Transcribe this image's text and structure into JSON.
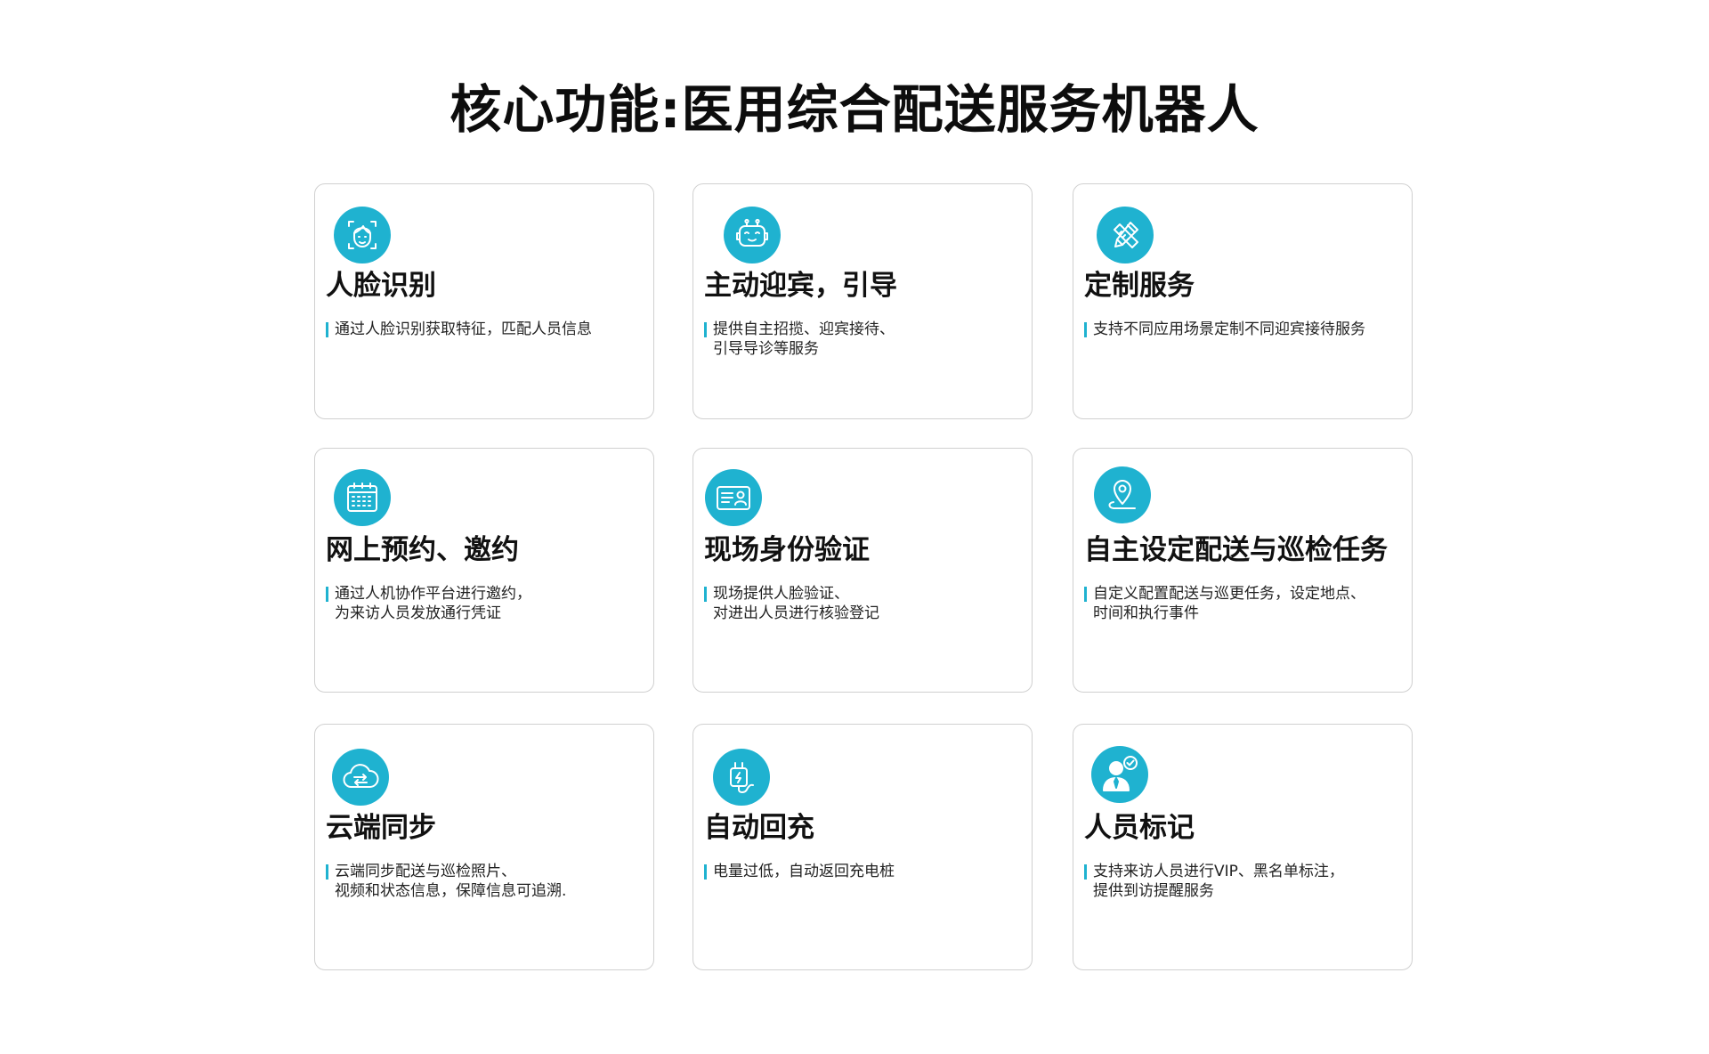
{
  "title": "核心功能:医用综合配送服务机器人",
  "colors": {
    "accent": "#1fb2d0",
    "border": "#d0d0d0",
    "text": "#111111"
  },
  "cards": [
    {
      "icon": "face-recognition-icon",
      "title": "人脸识别",
      "desc": [
        "通过人脸识别获取特征，匹配人员信息"
      ]
    },
    {
      "icon": "robot-icon",
      "title": "主动迎宾，引导",
      "desc": [
        "提供自主招揽、迎宾接待、",
        "引导导诊等服务"
      ]
    },
    {
      "icon": "pencil-ruler-icon",
      "title": "定制服务",
      "desc": [
        "支持不同应用场景定制不同迎宾接待服务"
      ]
    },
    {
      "icon": "calendar-icon",
      "title": "网上预约、邀约",
      "desc": [
        "通过人机协作平台进行邀约，",
        "为来访人员发放通行凭证"
      ]
    },
    {
      "icon": "id-card-icon",
      "title": "现场身份验证",
      "desc": [
        "现场提供人脸验证、",
        "对进出人员进行核验登记"
      ]
    },
    {
      "icon": "location-pin-icon",
      "title": "自主设定配送与巡检任务",
      "desc": [
        "自定义配置配送与巡更任务，设定地点、",
        "时间和执行事件"
      ]
    },
    {
      "icon": "cloud-sync-icon",
      "title": "云端同步",
      "desc": [
        "云端同步配送与巡检照片、",
        "视频和状态信息，保障信息可追溯."
      ]
    },
    {
      "icon": "charging-plug-icon",
      "title": "自动回充",
      "desc": [
        "电量过低，自动返回充电桩"
      ]
    },
    {
      "icon": "person-badge-icon",
      "title": "人员标记",
      "desc": [
        "支持来访人员进行VIP、黑名单标注，",
        "提供到访提醒服务"
      ]
    }
  ]
}
